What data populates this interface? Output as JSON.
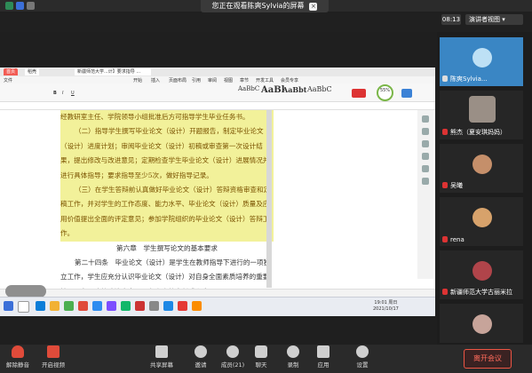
{
  "meeting": {
    "share_banner": "您正在观看陈爽Sylvia的屏幕",
    "time": "08:13",
    "view_button": "演讲者视图"
  },
  "screen": {
    "tabs": [
      "首页",
      "稻壳",
      "新疆师范大学...计】要求指导 ..."
    ],
    "menu": [
      "文件",
      "开始",
      "插入",
      "页面布局",
      "引用",
      "审阅",
      "视图",
      "章节",
      "开发工具",
      "会员专享"
    ],
    "styles": [
      "AaBbC",
      "AaBl",
      "AaBbt",
      "AaBbC"
    ],
    "percent": "55%",
    "doc_lines": {
      "l1": "经教研室主任、学院领导小组批准后方可指导学生毕业任务书。",
      "p2": "（二）指导学生撰写毕业论文（设计）开题报告，制定毕业论文（设计）进度计划；审阅毕业论文（设计）初稿或审查第一次设计结果，提出修改与改进意见；定期检查学生毕业论文（设计）进展情况并进行具体指导；要求指导至少5次，做好指导记录。",
      "p3": "（三）在学生答辩前认真做好毕业论文（设计）答辩资格审查和定稿工作，并对学生的工作态度、能力水平、毕业论文（设计）质量及应用价值提出全面的评定意见；参加学院组织的毕业论文（设计）答辩工作。",
      "chapter": "第六章　学生撰写论文的基本要求",
      "p4": "第二十四条　毕业论文（设计）是学生在教师指导下进行的一项独立工作，学生应充分认识毕业论文（设计）对自身全面素质培养的重要性，要有正确的政治方向，具备高度的责任感和自"
    },
    "clock": "19:01 周日\n2021/10/17"
  },
  "participants": [
    {
      "name": "陈爽Sylvia..."
    },
    {
      "name": "熊杰（夏安琪妈妈）"
    },
    {
      "name": "吴曦"
    },
    {
      "name": "rena"
    },
    {
      "name": "新疆师范大学古丽米拉"
    },
    {
      "name": ""
    }
  ],
  "toolbar": {
    "mute": "解除静音",
    "video": "开启视频",
    "share": "共享屏幕",
    "invite": "邀请",
    "members": "成员(21)",
    "chat": "聊天",
    "record": "录制",
    "apps": "应用",
    "settings": "设置",
    "leave": "离开会议"
  },
  "colors": {
    "highlight": "#f2f19a",
    "leave": "#ff6b5b"
  }
}
